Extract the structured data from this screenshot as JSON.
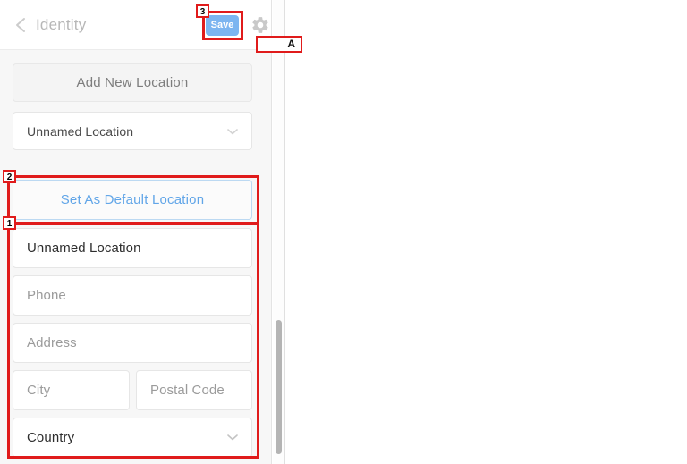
{
  "header": {
    "back_icon": "chevron-left-icon",
    "title": "Identity",
    "save_label": "Save",
    "gear_icon": "gear-icon"
  },
  "content": {
    "add_new_location_label": "Add New Location",
    "location_select_value": "Unnamed Location",
    "location_select_icon": "chevron-down-icon",
    "set_as_default_label": "Set As Default Location",
    "fields": {
      "name_value": "Unnamed Location",
      "phone_placeholder": "Phone",
      "address_placeholder": "Address",
      "city_placeholder": "City",
      "postal_placeholder": "Postal Code",
      "country_value": "Country",
      "country_icon": "chevron-down-icon"
    }
  },
  "annotations": {
    "tag_1": "1",
    "tag_2": "2",
    "tag_3": "3",
    "label_a": "A"
  },
  "colors": {
    "save_button": "#7cb5f0",
    "accent_blue": "#62a6e8",
    "annotation_red": "#e01b1b",
    "body_background": "#f7f7f7"
  }
}
